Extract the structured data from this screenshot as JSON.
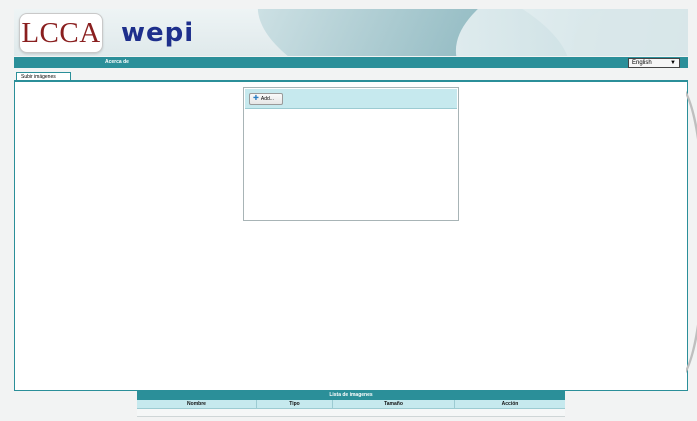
{
  "header": {
    "logo_text": "LCCA",
    "brand_text": "wepi"
  },
  "navbar": {
    "about_label": "Acerca de",
    "language": {
      "selected": "English",
      "arrow": "▼"
    }
  },
  "tabs": [
    {
      "label": "Subir imágenes",
      "active": true
    }
  ],
  "upload": {
    "add_label": "Add...",
    "add_icon": "plus-icon"
  },
  "image_list": {
    "title": "Lista de imagenes",
    "columns": [
      "Nombre",
      "Tipo",
      "Tamaño",
      "Acción"
    ]
  },
  "colors": {
    "accent": "#2b8f99",
    "panel_header": "#c6e9ee",
    "logo_red": "#8a1f1f",
    "brand_blue": "#1e2f8c"
  }
}
